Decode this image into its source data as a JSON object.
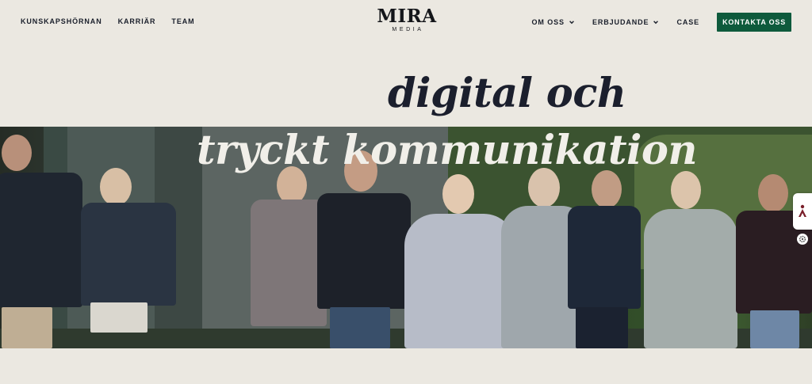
{
  "header": {
    "left_nav": [
      "KUNSKAPSHÖRNAN",
      "KARRIÄR",
      "TEAM"
    ],
    "logo": {
      "main": "MIRA",
      "sub": "MEDIA"
    },
    "right_nav": [
      {
        "label": "OM OSS",
        "has_dropdown": true
      },
      {
        "label": "ERBJUDANDE",
        "has_dropdown": true
      },
      {
        "label": "CASE",
        "has_dropdown": false
      }
    ],
    "cta_label": "KONTAKTA OSS"
  },
  "hero": {
    "line1": "digital och",
    "line2": "tryckt kommunikation"
  },
  "colors": {
    "background": "#ebe8e1",
    "cta": "#0e5a3c",
    "text": "#1a1f2b",
    "title_light": "#f1efe9"
  },
  "icons": {
    "dropdown": "chevron-down-icon",
    "accessibility": "accessibility-icon",
    "settings": "gear-icon"
  }
}
